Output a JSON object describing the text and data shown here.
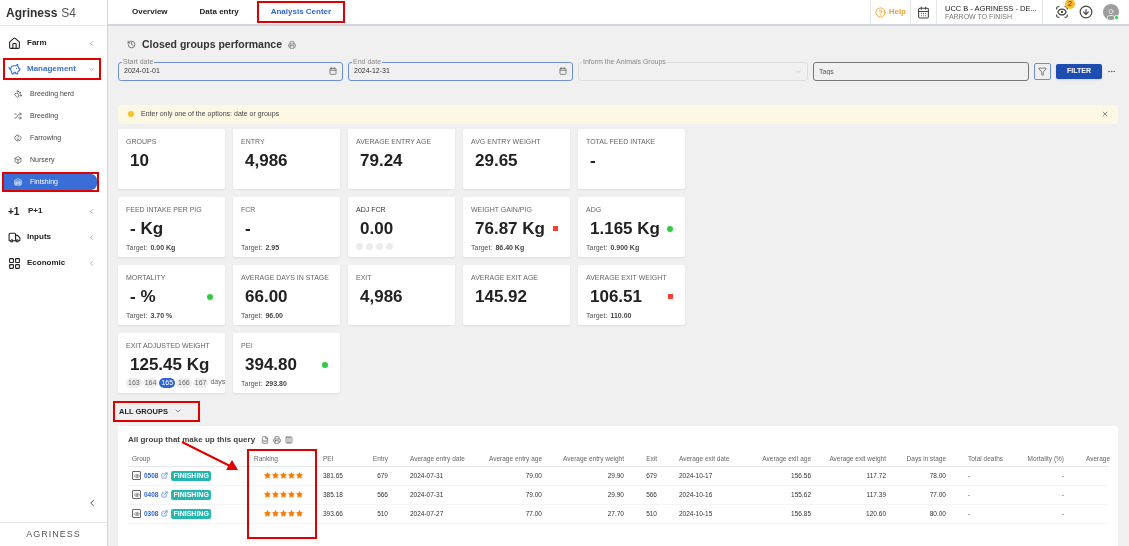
{
  "sidebar": {
    "brand": "Agriness",
    "brand_suffix": "S4",
    "footer_logo": "AGRINESS",
    "items": [
      {
        "label": "Farm",
        "kind": "farm",
        "expanded": false,
        "selected": false,
        "highlighted": false
      },
      {
        "label": "Management",
        "kind": "management",
        "expanded": true,
        "selected": true,
        "highlighted": true,
        "children": [
          {
            "label": "Breeding herd",
            "selected": false,
            "highlighted": false
          },
          {
            "label": "Breeding",
            "selected": false,
            "highlighted": false
          },
          {
            "label": "Farrowing",
            "selected": false,
            "highlighted": false
          },
          {
            "label": "Nursery",
            "selected": false,
            "highlighted": false
          },
          {
            "label": "Finishing",
            "selected": true,
            "highlighted": true
          }
        ]
      },
      {
        "label": "P+1",
        "kind": "plus",
        "icon_text": "+1",
        "expanded": false,
        "selected": false,
        "highlighted": false
      },
      {
        "label": "Inputs",
        "kind": "inputs",
        "expanded": false,
        "selected": false,
        "highlighted": false
      },
      {
        "label": "Economic",
        "kind": "economic",
        "expanded": false,
        "selected": false,
        "highlighted": false
      }
    ]
  },
  "tabs": [
    {
      "label": "Overview",
      "selected": false,
      "highlighted": false
    },
    {
      "label": "Data entry",
      "selected": false,
      "highlighted": false
    },
    {
      "label": "Analysis Center",
      "selected": true,
      "highlighted": true
    }
  ],
  "header": {
    "help": "Help",
    "farm_name": "UCC B - AGRINESS - DE...",
    "farm_type": "FARROW TO FINISH",
    "notification_count": "2",
    "online": true
  },
  "page_title": "Closed groups performance",
  "filters": {
    "start_date": {
      "label": "Start date",
      "value": "2024-01-01"
    },
    "end_date": {
      "label": "End date",
      "value": "2024-12-31"
    },
    "groups": {
      "label": "Inform the Animals Groups",
      "disabled": true
    },
    "tags": {
      "placeholder": "Tags"
    },
    "filter_button": "FILTER"
  },
  "alert": "Enter only one of the options: date or groups",
  "cards": [
    {
      "kind": "plain",
      "title": "GROUPS",
      "value": "10"
    },
    {
      "kind": "plain",
      "title": "ENTRY",
      "value": "4,986"
    },
    {
      "kind": "plain",
      "title": "AVERAGE ENTRY AGE",
      "value": "79.24"
    },
    {
      "kind": "plain",
      "title": "AVG ENTRY WEIGHT",
      "value": "29.65"
    },
    {
      "kind": "plain",
      "title": "TOTAL FEED INTAKE",
      "value": "-"
    },
    {
      "kind": "target",
      "title": "FEED INTAKE PER PIG",
      "value": "- Kg",
      "target_label": "Target:",
      "target": "0.00 Kg"
    },
    {
      "kind": "target",
      "title": "FCR",
      "value": "-",
      "target_label": "Target:",
      "target": "2.95"
    },
    {
      "kind": "empty_chips",
      "title": "ADJ FCR",
      "value": "0.00"
    },
    {
      "kind": "target",
      "title": "WEIGHT GAIN/PIG",
      "value": "76.87 Kg",
      "indicator": {
        "kind": "square",
        "color": "#f44336"
      },
      "target_label": "Target:",
      "target": "86.40 Kg"
    },
    {
      "kind": "target",
      "title": "ADG",
      "value": "1.165 Kg",
      "indicator": {
        "kind": "dot",
        "color": "#2ecc40"
      },
      "target_label": "Target:",
      "target": "0.900 Kg"
    },
    {
      "kind": "target",
      "title": "MORTALITY",
      "value": "- %",
      "indicator": {
        "kind": "dot",
        "color": "#2ecc40"
      },
      "target_label": "Target:",
      "target": "3.70 %"
    },
    {
      "kind": "target",
      "title": "AVERAGE DAYS IN STAGE",
      "value": "66.00",
      "target_label": "Target:",
      "target": "96.00"
    },
    {
      "kind": "plain",
      "title": "EXIT",
      "value": "4,986"
    },
    {
      "kind": "plain",
      "title": "AVERAGE EXIT AGE",
      "value": "145.92"
    },
    {
      "kind": "target",
      "title": "AVERAGE EXIT WEIGHT",
      "value": "106.51",
      "indicator": {
        "kind": "square",
        "color": "#f44336"
      },
      "target_label": "Target:",
      "target": "110.00"
    },
    {
      "kind": "chips",
      "title": "EXIT ADJUSTED WEIGHT",
      "value": "125.45 Kg",
      "chips": [
        {
          "label": "163",
          "selected": false
        },
        {
          "label": "164",
          "selected": false
        },
        {
          "label": "165",
          "selected": true
        },
        {
          "label": "166",
          "selected": false
        },
        {
          "label": "167",
          "selected": false
        }
      ],
      "chips_unit": "days"
    },
    {
      "kind": "target",
      "title": "PEI",
      "value": "394.80",
      "indicator": {
        "kind": "dot",
        "color": "#2ecc40"
      },
      "target_label": "Target:",
      "target": "293.80"
    }
  ],
  "groups_section": {
    "label": "ALL GROUPS",
    "highlighted": true,
    "title": "All group that make up this query",
    "arrow": true,
    "columns": [
      {
        "label": "Group",
        "highlighted": false
      },
      {
        "label": "Ranking",
        "highlighted": true
      },
      {
        "label": "PEI",
        "highlighted": false
      },
      {
        "label": "Entry",
        "highlighted": false
      },
      {
        "label": "Average entry date",
        "highlighted": false
      },
      {
        "label": "Average entry age",
        "highlighted": false
      },
      {
        "label": "Average entry weight",
        "highlighted": false
      },
      {
        "label": "Exit",
        "highlighted": false
      },
      {
        "label": "Average exit date",
        "highlighted": false
      },
      {
        "label": "Average exit age",
        "highlighted": false
      },
      {
        "label": "Average exit weight",
        "highlighted": false
      },
      {
        "label": "Days in stage",
        "highlighted": false
      },
      {
        "label": "Total deaths",
        "highlighted": false
      },
      {
        "label": "Mortality (%)",
        "highlighted": false
      },
      {
        "label": "Average",
        "highlighted": false
      }
    ],
    "rows": [
      {
        "cells": [
          {
            "group": "0508",
            "stage": "FINISHING"
          },
          {
            "stars": 5
          },
          "381.65",
          "679",
          "2024-07-31",
          "79.00",
          "29.90",
          "679",
          "2024-10-17",
          "156.56",
          "117.72",
          "78.00",
          "-",
          "-"
        ]
      },
      {
        "cells": [
          {
            "group": "0408",
            "stage": "FINISHING"
          },
          {
            "stars": 5
          },
          "385.18",
          "566",
          "2024-07-31",
          "79.00",
          "29.90",
          "566",
          "2024-10-16",
          "155.62",
          "117.39",
          "77.00",
          "-",
          "-"
        ]
      },
      {
        "cells": [
          {
            "group": "0308",
            "stage": "FINISHING"
          },
          {
            "stars": 5
          },
          "393.66",
          "510",
          "2024-07-27",
          "77.00",
          "27.70",
          "510",
          "2024-10-15",
          "156.85",
          "120.60",
          "80.00",
          "-",
          "-"
        ]
      }
    ]
  }
}
